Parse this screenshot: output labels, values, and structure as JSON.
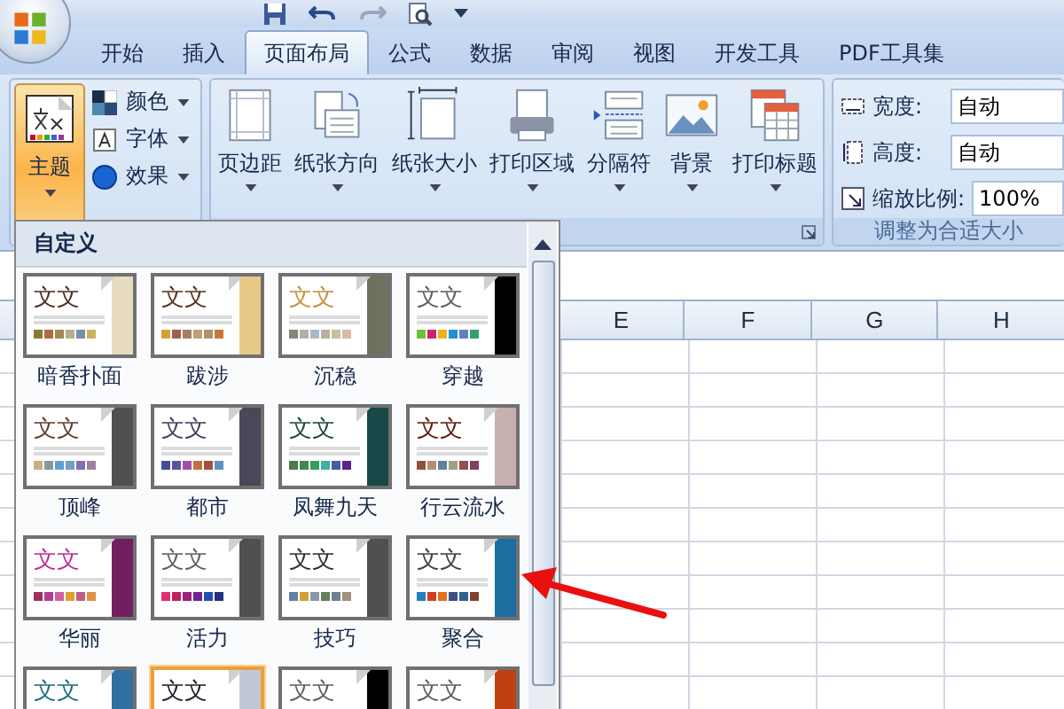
{
  "tabs": [
    {
      "label": "开始",
      "selected": false
    },
    {
      "label": "插入",
      "selected": false
    },
    {
      "label": "页面布局",
      "selected": true
    },
    {
      "label": "公式",
      "selected": false
    },
    {
      "label": "数据",
      "selected": false
    },
    {
      "label": "审阅",
      "selected": false
    },
    {
      "label": "视图",
      "selected": false
    },
    {
      "label": "开发工具",
      "selected": false
    },
    {
      "label": "PDF工具集",
      "selected": false
    }
  ],
  "themes_group": {
    "main_button": {
      "label": "主题",
      "expanded": true
    },
    "options": [
      {
        "label": "颜色",
        "kind": "colors"
      },
      {
        "label": "字体",
        "kind": "fonts"
      },
      {
        "label": "效果",
        "kind": "effects"
      }
    ]
  },
  "page_setup_group": {
    "buttons": [
      {
        "label": "页边距",
        "kind": "margins"
      },
      {
        "label": "纸张方向",
        "kind": "orientation"
      },
      {
        "label": "纸张大小",
        "kind": "size"
      },
      {
        "label": "打印区域",
        "kind": "print_area"
      },
      {
        "label": "分隔符",
        "kind": "breaks"
      },
      {
        "label": "背景",
        "kind": "background"
      },
      {
        "label": "打印标题",
        "kind": "print_titles"
      }
    ]
  },
  "scale_group": {
    "fields": [
      {
        "label": "宽度:",
        "value": "自动",
        "kind": "width"
      },
      {
        "label": "高度:",
        "value": "自动",
        "kind": "height"
      },
      {
        "label": "缩放比例:",
        "value": "100%",
        "kind": "scale"
      }
    ],
    "caption": "调整为合适大小"
  },
  "theme_menu": {
    "header": "自定义",
    "themes": [
      {
        "name": "暗香扑面",
        "sample": {
          "text": "文文",
          "color": "#4a3020"
        },
        "color": "#e8dcc0",
        "selected": false,
        "swatches": [
          {
            "color": "#8a7a30"
          },
          {
            "color": "#b06a40"
          },
          {
            "color": "#a08858"
          },
          {
            "color": "#b8b088"
          },
          {
            "color": "#7890a8"
          },
          {
            "color": "#d0b060"
          }
        ]
      },
      {
        "name": "跋涉",
        "sample": {
          "text": "文文",
          "color": "#5a3020"
        },
        "color": "#e8c888",
        "selected": false,
        "swatches": [
          {
            "color": "#d8a030"
          },
          {
            "color": "#a06050"
          },
          {
            "color": "#a08060"
          },
          {
            "color": "#c0a070"
          },
          {
            "color": "#b09070"
          },
          {
            "color": "#c87838"
          }
        ]
      },
      {
        "name": "沉稳",
        "sample": {
          "text": "文文",
          "color": "#c89040"
        },
        "color": "#707060",
        "selected": false,
        "swatches": [
          {
            "color": "#808878"
          },
          {
            "color": "#b0b0a8"
          },
          {
            "color": "#a8b8c8"
          },
          {
            "color": "#b8b0a0"
          },
          {
            "color": "#c8c098"
          },
          {
            "color": "#d8b8a8"
          }
        ]
      },
      {
        "name": "穿越",
        "sample": {
          "text": "文文",
          "color": "#606060"
        },
        "color": "#000000",
        "selected": false,
        "swatches": [
          {
            "color": "#70c040"
          },
          {
            "color": "#d02070"
          },
          {
            "color": "#f0b020"
          },
          {
            "color": "#2090d0"
          },
          {
            "color": "#6080c0"
          },
          {
            "color": "#30a070"
          }
        ]
      },
      {
        "name": "顶峰",
        "sample": {
          "text": "文文",
          "color": "#604030"
        },
        "color": "#505050",
        "selected": false,
        "swatches": [
          {
            "color": "#c8b080"
          },
          {
            "color": "#8898a0"
          },
          {
            "color": "#60a0d0"
          },
          {
            "color": "#70a0c8"
          },
          {
            "color": "#8070b0"
          },
          {
            "color": "#a080a0"
          }
        ]
      },
      {
        "name": "都市",
        "sample": {
          "text": "文文",
          "color": "#404060"
        },
        "color": "#484858",
        "selected": false,
        "swatches": [
          {
            "color": "#405090"
          },
          {
            "color": "#6050a0"
          },
          {
            "color": "#a050a0"
          },
          {
            "color": "#c07040"
          },
          {
            "color": "#a05040"
          },
          {
            "color": "#6090c0"
          }
        ]
      },
      {
        "name": "凤舞九天",
        "sample": {
          "text": "文文",
          "color": "#204840"
        },
        "color": "#184848",
        "selected": false,
        "swatches": [
          {
            "color": "#507850"
          },
          {
            "color": "#408850"
          },
          {
            "color": "#30a060"
          },
          {
            "color": "#40b0a0"
          },
          {
            "color": "#4060a0"
          },
          {
            "color": "#602090"
          }
        ]
      },
      {
        "name": "行云流水",
        "sample": {
          "text": "文文",
          "color": "#602010"
        },
        "color": "#c8b0b0",
        "selected": false,
        "swatches": [
          {
            "color": "#905040"
          },
          {
            "color": "#b09070"
          },
          {
            "color": "#6080a0"
          },
          {
            "color": "#a0a080"
          },
          {
            "color": "#905050"
          },
          {
            "color": "#804060"
          }
        ]
      },
      {
        "name": "华丽",
        "sample": {
          "text": "文文",
          "color": "#c03090"
        },
        "color": "#702060",
        "selected": false,
        "swatches": [
          {
            "color": "#a03060"
          },
          {
            "color": "#b04090"
          },
          {
            "color": "#d060a0"
          },
          {
            "color": "#e0a030"
          },
          {
            "color": "#c06080"
          },
          {
            "color": "#e09040"
          }
        ]
      },
      {
        "name": "活力",
        "sample": {
          "text": "文文",
          "color": "#606060"
        },
        "color": "#505050",
        "selected": false,
        "swatches": [
          {
            "color": "#e03070"
          },
          {
            "color": "#c02060"
          },
          {
            "color": "#a02080"
          },
          {
            "color": "#702090"
          },
          {
            "color": "#2050b0"
          },
          {
            "color": "#203080"
          }
        ]
      },
      {
        "name": "技巧",
        "sample": {
          "text": "文文",
          "color": "#303030"
        },
        "color": "#505050",
        "selected": false,
        "swatches": [
          {
            "color": "#6080a0"
          },
          {
            "color": "#d0a030"
          },
          {
            "color": "#8898a8"
          },
          {
            "color": "#608060"
          },
          {
            "color": "#708090"
          },
          {
            "color": "#a09080"
          }
        ]
      },
      {
        "name": "聚合",
        "sample": {
          "text": "文文",
          "color": "#404040"
        },
        "color": "#1a6fa0",
        "selected": false,
        "swatches": [
          {
            "color": "#2080c0"
          },
          {
            "color": "#d04020"
          },
          {
            "color": "#e07020"
          },
          {
            "color": "#405080"
          },
          {
            "color": "#306090"
          },
          {
            "color": "#804030"
          }
        ]
      },
      {
        "sample": {
          "text": "文文",
          "color": "#207080"
        },
        "color": "#3070a0",
        "selected": false
      },
      {
        "sample": {
          "text": "文文",
          "color": "#202030"
        },
        "color": "#c0c8d8",
        "selected": true
      },
      {
        "sample": {
          "text": "文文",
          "color": "#606060"
        },
        "color": "#000000",
        "selected": false
      },
      {
        "sample": {
          "text": "文文",
          "color": "#606060"
        },
        "color": "#c04010",
        "selected": false
      }
    ]
  },
  "sheet": {
    "columns": [
      "E",
      "F",
      "G",
      "H"
    ]
  }
}
